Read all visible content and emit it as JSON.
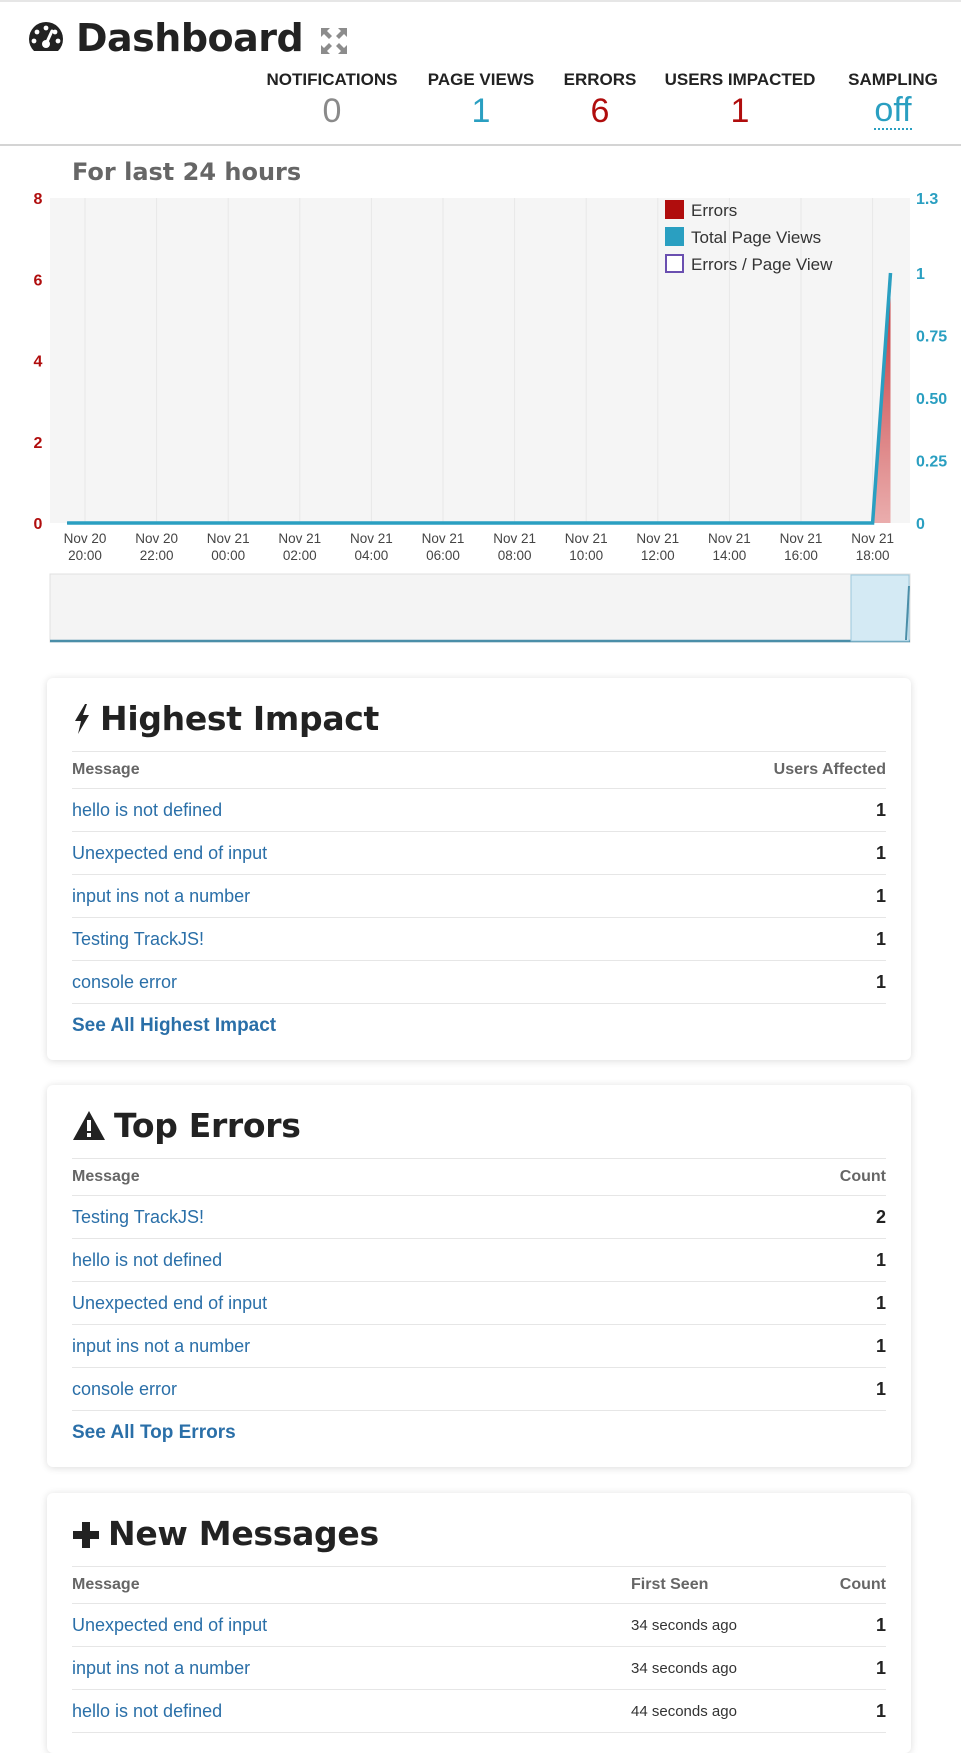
{
  "header": {
    "title": "Dashboard",
    "stats": {
      "notifications": {
        "label": "NOTIFICATIONS",
        "value": "0"
      },
      "page_views": {
        "label": "PAGE VIEWS",
        "value": "1"
      },
      "errors": {
        "label": "ERRORS",
        "value": "6"
      },
      "users_impacted": {
        "label": "USERS IMPACTED",
        "value": "1"
      },
      "sampling": {
        "label": "SAMPLING",
        "value": "off"
      }
    }
  },
  "chart_section": {
    "title": "For last 24 hours"
  },
  "chart_data": {
    "type": "area",
    "x_ticks": [
      {
        "date": "Nov 20",
        "time": "20:00"
      },
      {
        "date": "Nov 20",
        "time": "22:00"
      },
      {
        "date": "Nov 21",
        "time": "00:00"
      },
      {
        "date": "Nov 21",
        "time": "02:00"
      },
      {
        "date": "Nov 21",
        "time": "04:00"
      },
      {
        "date": "Nov 21",
        "time": "06:00"
      },
      {
        "date": "Nov 21",
        "time": "08:00"
      },
      {
        "date": "Nov 21",
        "time": "10:00"
      },
      {
        "date": "Nov 21",
        "time": "12:00"
      },
      {
        "date": "Nov 21",
        "time": "14:00"
      },
      {
        "date": "Nov 21",
        "time": "16:00"
      },
      {
        "date": "Nov 21",
        "time": "18:00"
      }
    ],
    "y_left": {
      "ticks": [
        "0",
        "2",
        "4",
        "6",
        "8"
      ],
      "range": [
        0,
        8
      ],
      "color": "#b00d0d"
    },
    "y_right": {
      "ticks": [
        "0",
        "0.25",
        "0.50",
        "0.75",
        "1",
        "1.3"
      ],
      "tick_values": [
        0,
        0.25,
        0.5,
        0.75,
        1,
        1.3
      ],
      "range": [
        0,
        1.3
      ],
      "color": "#2a9fc1"
    },
    "series": [
      {
        "name": "Errors",
        "color": "#b00d0d",
        "axis": "left",
        "x": [
          "Nov 20 19:30",
          "Nov 21 18:00",
          "Nov 21 18:30"
        ],
        "values": [
          0,
          0,
          6
        ]
      },
      {
        "name": "Total Page Views",
        "color": "#2a9fc1",
        "axis": "right",
        "x": [
          "Nov 20 19:30",
          "Nov 21 18:00",
          "Nov 21 18:30"
        ],
        "values": [
          0,
          0,
          1
        ]
      },
      {
        "name": "Errors / Page View",
        "color": "#6a4fb0",
        "axis": "right",
        "x": [],
        "values": []
      }
    ],
    "legend": "top-right",
    "grid": true
  },
  "highest_impact": {
    "title": "Highest Impact",
    "headers": {
      "message": "Message",
      "count": "Users Affected"
    },
    "rows": [
      {
        "message": "hello is not defined",
        "count": "1"
      },
      {
        "message": "Unexpected end of input",
        "count": "1"
      },
      {
        "message": "input ins not a number",
        "count": "1"
      },
      {
        "message": "Testing TrackJS!",
        "count": "1"
      },
      {
        "message": "console error",
        "count": "1"
      }
    ],
    "see_all": "See All Highest Impact"
  },
  "top_errors": {
    "title": "Top Errors",
    "headers": {
      "message": "Message",
      "count": "Count"
    },
    "rows": [
      {
        "message": "Testing TrackJS!",
        "count": "2"
      },
      {
        "message": "hello is not defined",
        "count": "1"
      },
      {
        "message": "Unexpected end of input",
        "count": "1"
      },
      {
        "message": "input ins not a number",
        "count": "1"
      },
      {
        "message": "console error",
        "count": "1"
      }
    ],
    "see_all": "See All Top Errors"
  },
  "new_messages": {
    "title": "New Messages",
    "headers": {
      "message": "Message",
      "first_seen": "First Seen",
      "count": "Count"
    },
    "rows": [
      {
        "message": "Unexpected end of input",
        "first_seen": "34 seconds ago",
        "count": "1"
      },
      {
        "message": "input ins not a number",
        "first_seen": "34 seconds ago",
        "count": "1"
      },
      {
        "message": "hello is not defined",
        "first_seen": "44 seconds ago",
        "count": "1"
      }
    ]
  },
  "icons": {
    "dashboard": "dashboard-gauge-icon",
    "expand": "expand-arrows-icon",
    "bolt": "bolt-icon",
    "warning": "warning-triangle-icon",
    "plus": "plus-icon"
  }
}
